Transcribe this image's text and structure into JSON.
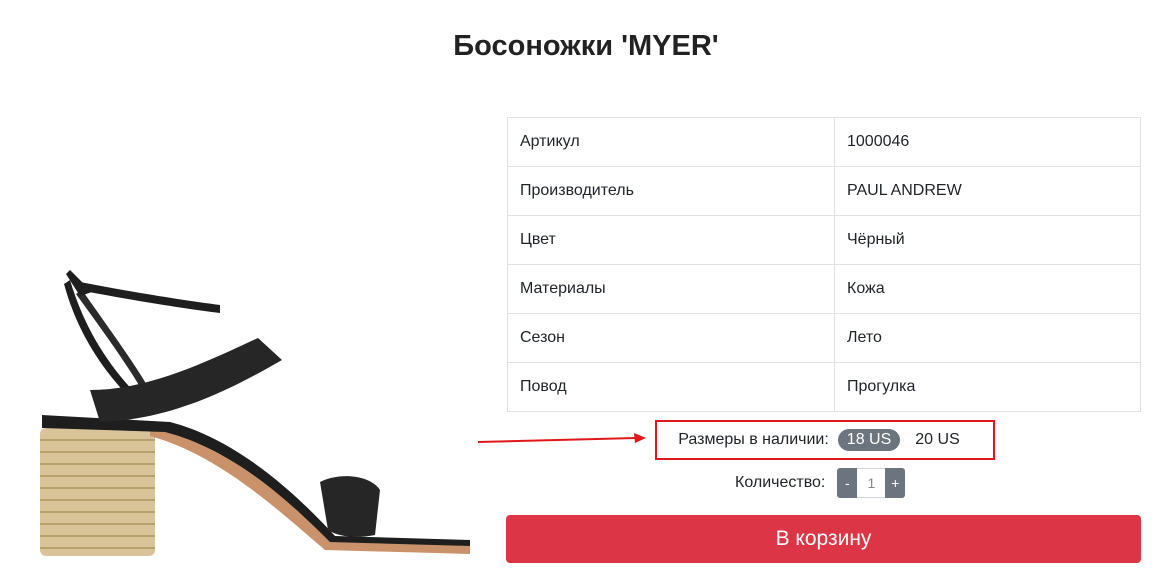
{
  "product": {
    "title": "Босоножки 'MYER'",
    "image_alt": "black-leather-sandal-with-espadrille-heel"
  },
  "specs": [
    {
      "key": "Артикул",
      "value": "1000046"
    },
    {
      "key": "Производитель",
      "value": "PAUL ANDREW"
    },
    {
      "key": "Цвет",
      "value": "Чёрный"
    },
    {
      "key": "Материалы",
      "value": "Кожа"
    },
    {
      "key": "Сезон",
      "value": "Лето"
    },
    {
      "key": "Повод",
      "value": "Прогулка"
    }
  ],
  "sizes": {
    "label": "Размеры в наличии:",
    "options": [
      {
        "label": "18 US",
        "selected": true
      },
      {
        "label": "20 US",
        "selected": false
      }
    ]
  },
  "quantity": {
    "label": "Количество:",
    "minus": "-",
    "value": "1",
    "plus": "+"
  },
  "cart_button": {
    "label": "В корзину"
  },
  "colors": {
    "accent_red": "#dc3545",
    "highlight_border": "#e0181b",
    "chip_grey": "#6c757d"
  }
}
